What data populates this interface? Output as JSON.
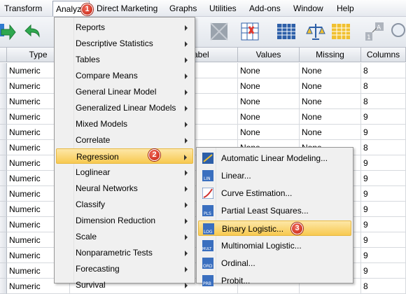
{
  "menubar": {
    "items": [
      "Transform",
      "Analyze",
      "Direct Marketing",
      "Graphs",
      "Utilities",
      "Add-ons",
      "Window",
      "Help"
    ],
    "active": "Analyze"
  },
  "grid": {
    "columns": [
      "Type",
      "abel",
      "Values",
      "Missing",
      "Columns"
    ],
    "rows": [
      [
        "Numeric",
        "None",
        "None",
        "8"
      ],
      [
        "Numeric",
        "None",
        "None",
        "8"
      ],
      [
        "Numeric",
        "None",
        "None",
        "8"
      ],
      [
        "Numeric",
        "None",
        "None",
        "9"
      ],
      [
        "Numeric",
        "None",
        "None",
        "9"
      ],
      [
        "Numeric",
        "None",
        "None",
        "8"
      ],
      [
        "Numeric",
        "",
        "",
        "9"
      ],
      [
        "Numeric",
        "",
        "",
        "9"
      ],
      [
        "Numeric",
        "",
        "",
        "9"
      ],
      [
        "Numeric",
        "",
        "",
        "9"
      ],
      [
        "Numeric",
        "",
        "",
        "9"
      ],
      [
        "Numeric",
        "",
        "",
        "9"
      ],
      [
        "Numeric",
        "",
        "",
        "9"
      ],
      [
        "Numeric",
        "",
        "",
        "9"
      ],
      [
        "Numeric",
        "",
        "",
        "8"
      ]
    ]
  },
  "analyze_menu": {
    "items": [
      "Reports",
      "Descriptive Statistics",
      "Tables",
      "Compare Means",
      "General Linear Model",
      "Generalized Linear Models",
      "Mixed Models",
      "Correlate",
      "Regression",
      "Loglinear",
      "Neural Networks",
      "Classify",
      "Dimension Reduction",
      "Scale",
      "Nonparametric Tests",
      "Forecasting",
      "Survival"
    ],
    "highlighted": "Regression"
  },
  "regression_menu": {
    "items": [
      {
        "label": "Automatic Linear Modeling...",
        "icon": "auto-linear-icon"
      },
      {
        "label": "Linear...",
        "icon": "linear-icon"
      },
      {
        "label": "Curve Estimation...",
        "icon": "curve-estimation-icon"
      },
      {
        "label": "Partial Least Squares...",
        "icon": "pls-icon"
      },
      {
        "label": "Binary Logistic...",
        "icon": "binary-logistic-icon"
      },
      {
        "label": "Multinomial Logistic...",
        "icon": "multinomial-icon"
      },
      {
        "label": "Ordinal...",
        "icon": "ordinal-icon"
      },
      {
        "label": "Probit...",
        "icon": "probit-icon"
      }
    ],
    "highlighted": "Binary Logistic..."
  },
  "badges": [
    "1",
    "2",
    "3"
  ],
  "colors": {
    "highlight": "#f7c950",
    "badge": "#c5200f",
    "menu_bg": "#f0f0f0"
  }
}
